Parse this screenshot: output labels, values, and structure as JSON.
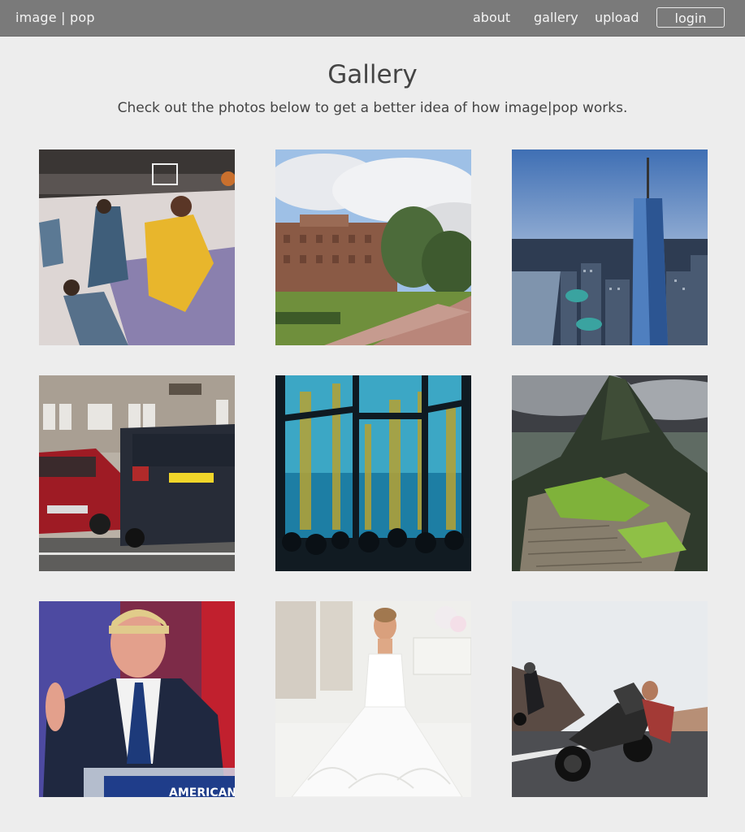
{
  "nav": {
    "brand": "image | pop",
    "links": [
      "about",
      "gallery",
      "upload"
    ],
    "login": "login"
  },
  "page": {
    "title": "Gallery",
    "subtitle": "Check out the photos below to get a better idea of how image|pop works."
  },
  "colors": {
    "navbar": "#7a7a7a",
    "background": "#ededed"
  }
}
